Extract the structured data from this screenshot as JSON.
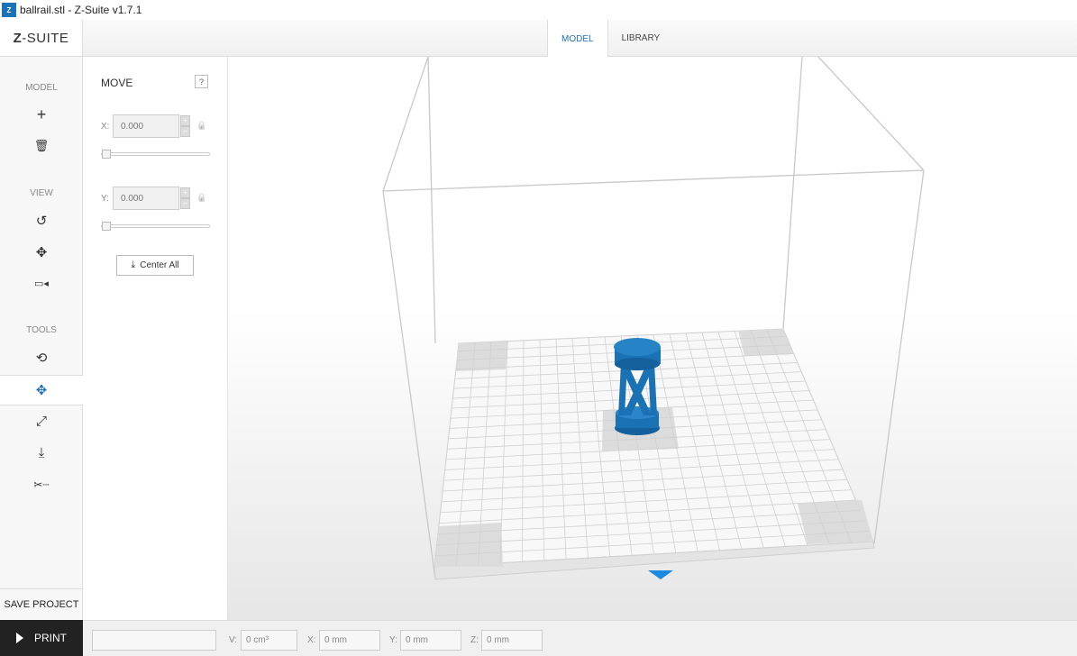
{
  "window": {
    "title": "ballrail.stl - Z-Suite v1.7.1",
    "app_icon": "z-suite-app-icon"
  },
  "logo": {
    "prefix": "Z",
    "suffix": "-SUITE"
  },
  "tabs": [
    {
      "label": "MODEL",
      "active": true
    },
    {
      "label": "LIBRARY",
      "active": false
    }
  ],
  "toolbar": {
    "model_header": "MODEL",
    "view_header": "VIEW",
    "tools_header": "TOOLS",
    "icons": {
      "add": "+",
      "delete": "🗑",
      "rotate_view": "↺",
      "pan": "✥",
      "camera": "▭◂",
      "rotate_tool": "⟲",
      "move_tool": "✥",
      "scale_tool": "⤢",
      "place_tool": "⤓",
      "cut_tool": "✂┈"
    },
    "save_project": "SAVE PROJECT",
    "print": "PRINT"
  },
  "panel": {
    "title": "MOVE",
    "help": "?",
    "x_label": "X:",
    "x_value": "0.000",
    "y_label": "Y:",
    "y_value": "0.000",
    "spin_up": "+",
    "spin_down": "–",
    "lock_icon": "🔒",
    "center_all_icon": "⤓",
    "center_all": "Center All"
  },
  "status": {
    "progress": "",
    "v_label": "V:",
    "v_value": "0 cm³",
    "x_label": "X:",
    "x_value": "0 mm",
    "y_label": "Y:",
    "y_value": "0 mm",
    "z_label": "Z:",
    "z_value": "0 mm"
  },
  "colors": {
    "accent": "#1f6fb2",
    "model": "#1a72b5",
    "print_bg": "#222222"
  }
}
